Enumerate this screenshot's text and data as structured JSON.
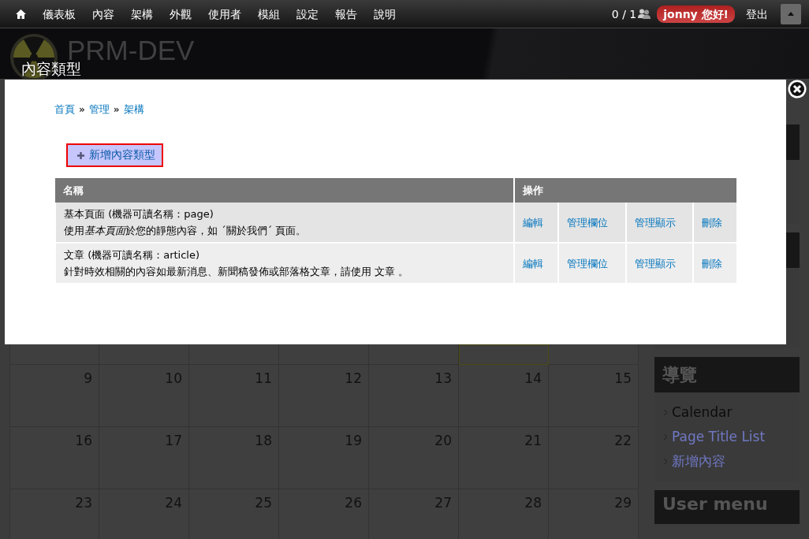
{
  "toolbar": {
    "items": [
      "儀表板",
      "內容",
      "架構",
      "外觀",
      "使用者",
      "模組",
      "設定",
      "報告",
      "說明"
    ],
    "user_count": "0 / 1",
    "greeting": "jonny 您好!",
    "logout": "登出"
  },
  "header": {
    "site_name": "PRM-DEV",
    "page_title": "內容類型"
  },
  "calendar": {
    "weeks": [
      [
        {
          "today": false
        },
        {
          "today": false
        },
        {
          "today": false
        },
        {
          "today": false
        },
        {
          "today": false
        },
        {
          "today": true
        },
        {
          "today": false
        }
      ],
      [
        {
          "day": "9",
          "today": false
        },
        {
          "day": "10",
          "today": false
        },
        {
          "day": "11",
          "today": false
        },
        {
          "day": "12",
          "today": false
        },
        {
          "day": "13",
          "today": false
        },
        {
          "day": "14",
          "today": false
        },
        {
          "day": "15",
          "today": false
        }
      ],
      [
        {
          "day": "16",
          "today": false
        },
        {
          "day": "17",
          "today": false
        },
        {
          "day": "18",
          "today": false
        },
        {
          "day": "19",
          "today": false
        },
        {
          "day": "20",
          "today": false
        },
        {
          "day": "21",
          "today": false
        },
        {
          "day": "22",
          "today": false
        }
      ],
      [
        {
          "day": "23",
          "today": false
        },
        {
          "day": "24",
          "today": false
        },
        {
          "day": "25",
          "today": false
        },
        {
          "day": "26",
          "today": false
        },
        {
          "day": "27",
          "today": false
        },
        {
          "day": "28",
          "today": false
        },
        {
          "day": "29",
          "today": false
        }
      ]
    ]
  },
  "sidebar": {
    "navigation": {
      "title": "導覽",
      "items": [
        {
          "label": "Calendar",
          "selected": true
        },
        {
          "label": "Page Title List",
          "selected": false
        },
        {
          "label": "新增內容",
          "selected": false
        }
      ]
    },
    "user_menu": {
      "title": "User menu"
    }
  },
  "modal": {
    "breadcrumb": {
      "separator": "»",
      "items": [
        "首頁",
        "管理",
        "架構"
      ]
    },
    "add_button": "新增內容類型",
    "table": {
      "columns": [
        "名稱",
        "操作"
      ],
      "rows": [
        {
          "name": "基本頁面 (機器可讀名稱：page)",
          "description": [
            {
              "text": "使用",
              "italic": false
            },
            {
              "text": "基本頁面",
              "italic": true
            },
            {
              "text": "於您的靜態內容，如 ´關於我們´ 頁面。",
              "italic": false
            }
          ],
          "operations": [
            "編輯",
            "管理欄位",
            "管理顯示",
            "刪除"
          ]
        },
        {
          "name": "文章 (機器可讀名稱：article)",
          "description": [
            {
              "text": "針對時效相關的內容如最新消息、新聞稿發佈或部落格文章，請使用 文章 。",
              "italic": false
            }
          ],
          "operations": [
            "編輯",
            "管理欄位",
            "管理顯示",
            "刪除"
          ]
        }
      ]
    }
  }
}
